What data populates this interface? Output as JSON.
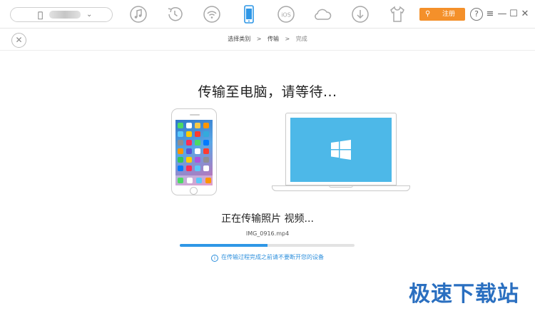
{
  "toolbar": {
    "device_icon": "apple-icon",
    "device_name": "iPhone",
    "icons": [
      "music-icon",
      "history-icon",
      "wifi-icon",
      "phone-icon",
      "ios-icon",
      "cloud-icon",
      "download-icon",
      "tshirt-icon"
    ],
    "register_label": "注册",
    "help_label": "?",
    "active_color": "#2f97e6",
    "register_color": "#f4902a"
  },
  "breadcrumb": {
    "step1": "选择类别",
    "sep": ">",
    "step2": "传输",
    "step3": "完成"
  },
  "main": {
    "title": "传输至电脑，请等待...",
    "status": "正在传输照片 视频...",
    "filename": "IMG_0916.mp4",
    "progress": 0.5,
    "notice": "在传输过程完成之前请不要断开您的设备"
  },
  "watermark": "极速下载站",
  "colors": {
    "progress_fill": "#2f97e6",
    "laptop_screen": "#4db8e8",
    "notice": "#2d8fdc"
  }
}
